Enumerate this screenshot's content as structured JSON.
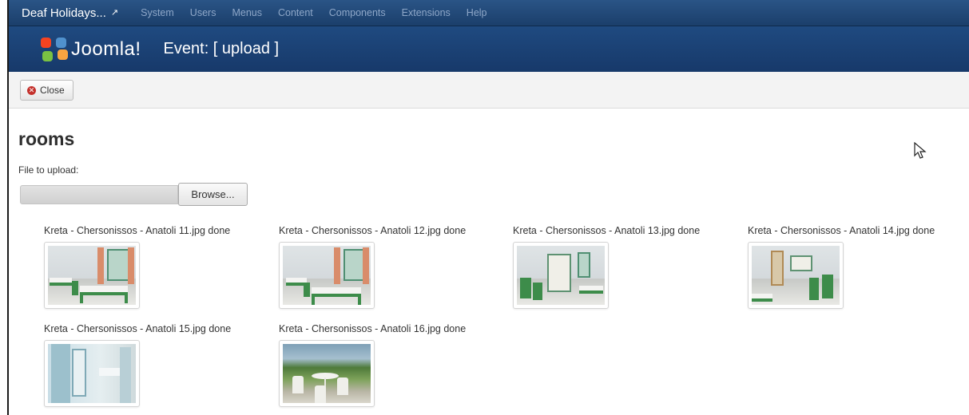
{
  "topnav": {
    "site_name": "Deaf Holidays...",
    "menu": [
      "System",
      "Users",
      "Menus",
      "Content",
      "Components",
      "Extensions",
      "Help"
    ]
  },
  "header": {
    "logo_text": "Joomla!",
    "heading": "Event: [ upload ]"
  },
  "toolbar": {
    "close_label": "Close"
  },
  "page": {
    "title": "rooms",
    "file_label": "File to upload:",
    "browse_label": "Browse..."
  },
  "uploads": [
    {
      "caption": "Kreta - Chersonissos - Anatoli 11.jpg done",
      "image": "room-twin-beds"
    },
    {
      "caption": "Kreta - Chersonissos - Anatoli 12.jpg done",
      "image": "room-twin-beds"
    },
    {
      "caption": "Kreta - Chersonissos - Anatoli 13.jpg done",
      "image": "room-balcony-door"
    },
    {
      "caption": "Kreta - Chersonissos - Anatoli 14.jpg done",
      "image": "room-kitchenette"
    },
    {
      "caption": "Kreta - Chersonissos - Anatoli 15.jpg done",
      "image": "bathroom"
    },
    {
      "caption": "Kreta - Chersonissos - Anatoli 16.jpg done",
      "image": "terrace"
    }
  ],
  "colors": {
    "nav_bg": "#1b3f6b",
    "header_bg": "#1f4a80",
    "toolbar_bg": "#f3f3f3",
    "close_icon": "#c4302b"
  }
}
